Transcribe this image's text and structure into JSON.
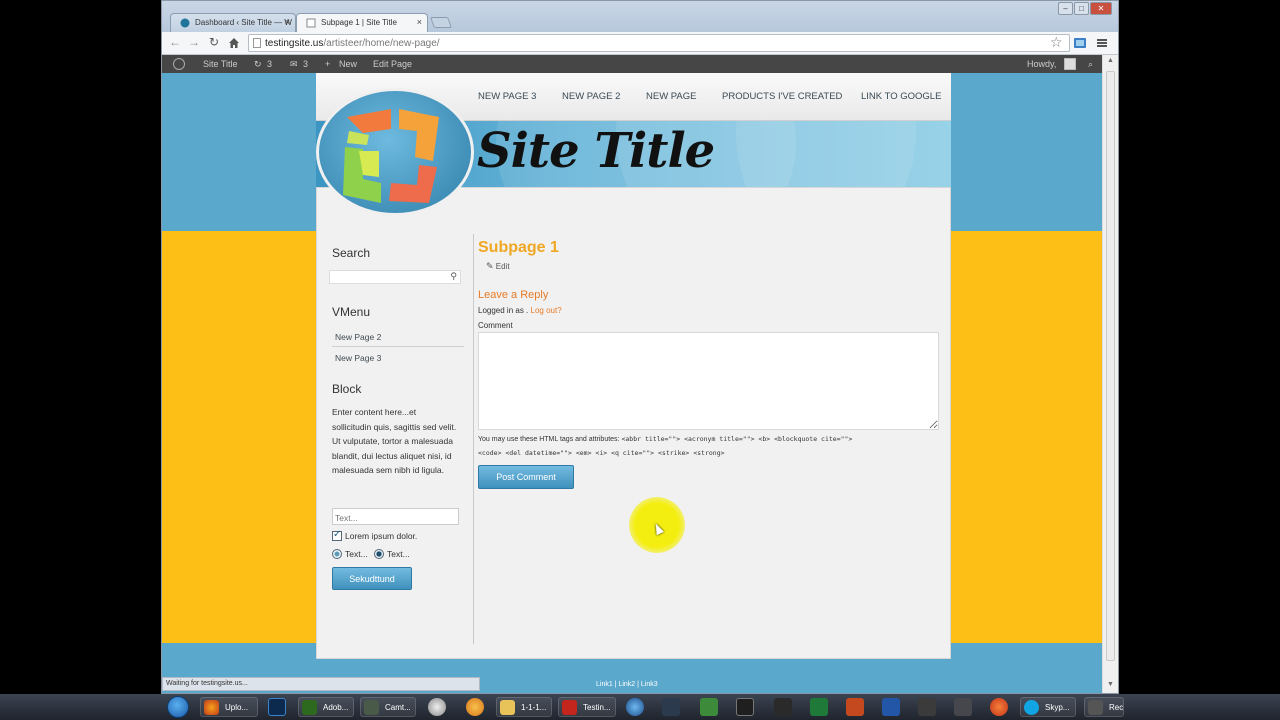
{
  "browser": {
    "tabs": [
      {
        "label": "Dashboard ‹ Site Title — W",
        "close": "×"
      },
      {
        "label": "Subpage 1 | Site Title",
        "close": "×"
      }
    ],
    "url_host": "testingsite.us",
    "url_path": "/artisteer/home/new-page/",
    "status_text": "Waiting for testingsite.us..."
  },
  "adminbar": {
    "site_title": "Site Title",
    "updates_count": "3",
    "comments_count": "3",
    "new_label": "New",
    "edit_page_label": "Edit Page",
    "howdy": "Howdy,"
  },
  "site": {
    "title": "Site Title",
    "menu": [
      "NEW PAGE 3",
      "NEW PAGE 2",
      "NEW PAGE",
      "PRODUCTS I'VE CREATED",
      "LINK TO GOOGLE"
    ]
  },
  "sidebar": {
    "search_heading": "Search",
    "vmenu_heading": "VMenu",
    "vmenu_items": [
      "New Page 2",
      "New Page 3"
    ],
    "block_heading": "Block",
    "block_text": "Enter content here...et sollicitudin quis, sagittis sed velit. Ut vulputate, tortor a malesuada blandit, dui lectus aliquet nisi, id malesuada sem nibh id ligula.",
    "text_placeholder": "Text...",
    "checkbox_label": "Lorem ipsum dolor.",
    "radio_labels": [
      "Text...",
      "Text..."
    ],
    "button_label": "Sekudttund"
  },
  "main": {
    "post_title": "Subpage 1",
    "edit_label": "Edit",
    "reply_title": "Leave a Reply",
    "logged_in_prefix": "Logged in as .",
    "logout_label": "Log out?",
    "comment_label": "Comment",
    "allowed_prefix": "You may use these HTML tags and attributes:",
    "allowed_tags_1": "<abbr title=\"\"> <acronym title=\"\"> <b> <blockquote cite=\"\">",
    "allowed_tags_2": "<code> <del datetime=\"\"> <em> <i> <q cite=\"\"> <strike> <strong>",
    "post_button": "Post Comment"
  },
  "footer": {
    "links": "Link1 | Link2 | Link3"
  },
  "taskbar": {
    "items": [
      "Uplo...",
      "Adob...",
      "Camt...",
      "1-1-1...",
      "Testin...",
      "Skyp...",
      "Rec"
    ]
  },
  "colors": {
    "accent_orange": "#f0a824",
    "link_orange": "#e67b27",
    "page_blue": "#5aa8cc",
    "page_yellow": "#fdbf16",
    "button_blue": "#4a9cc7"
  }
}
